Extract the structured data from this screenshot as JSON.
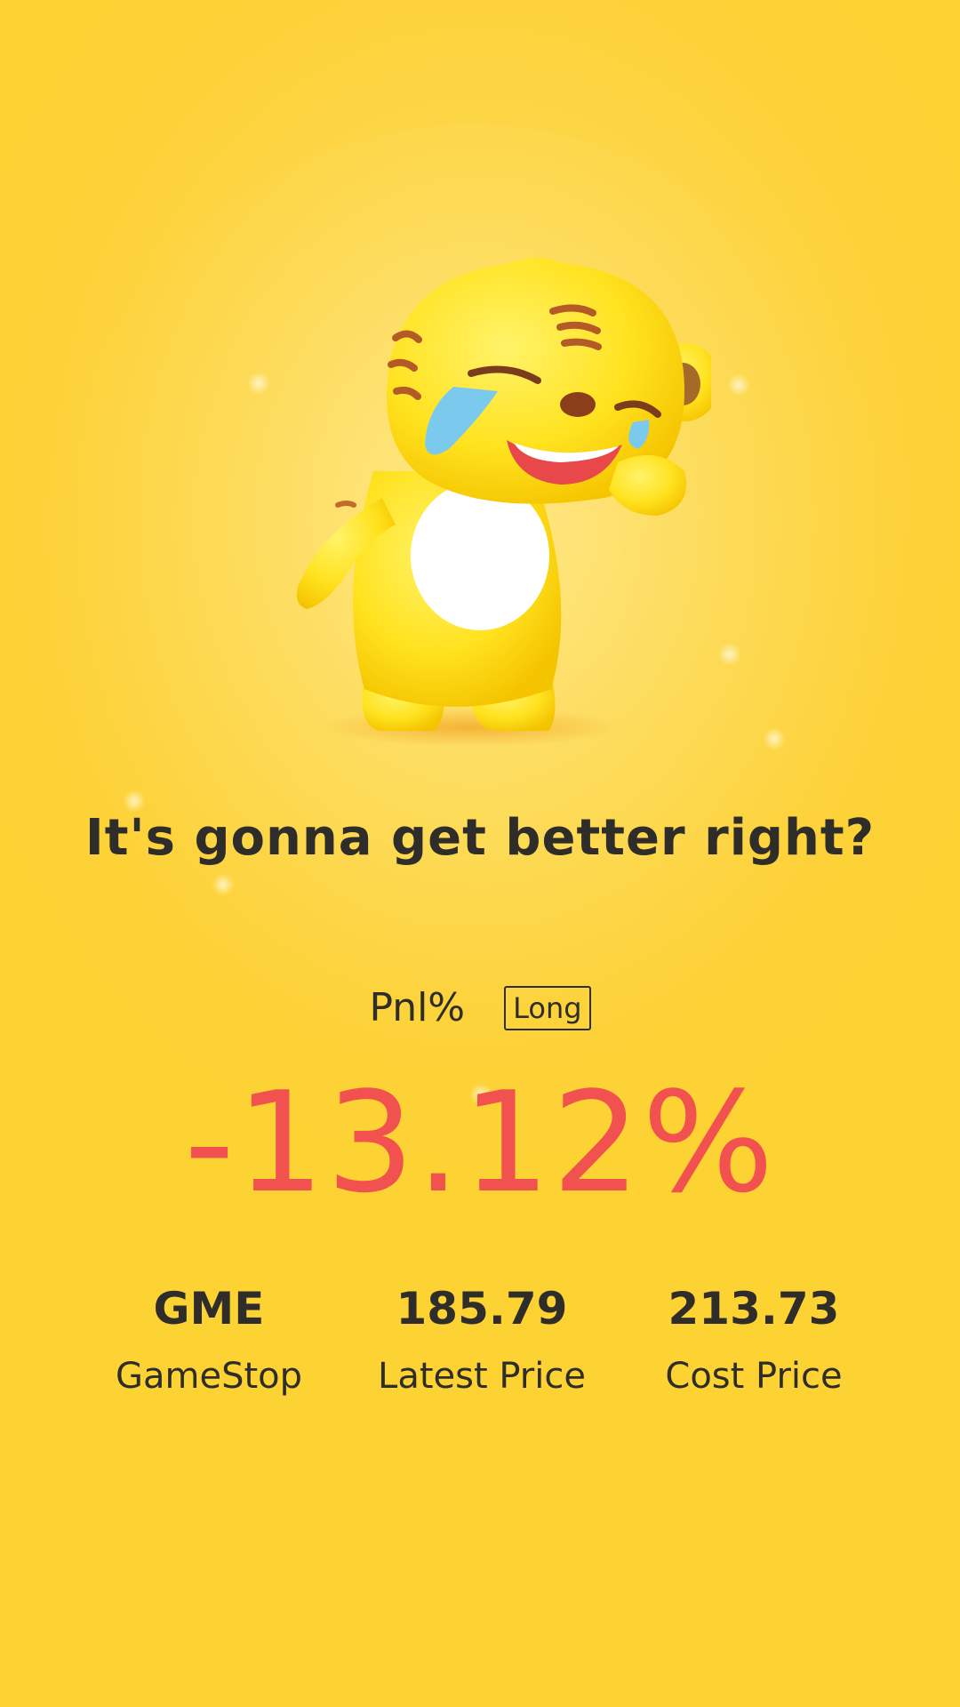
{
  "headline": "It's gonna get better right?",
  "pnl": {
    "label": "Pnl%",
    "position_badge": "Long",
    "value": "-13.12%",
    "value_color": "#f2524f"
  },
  "stats": [
    {
      "value": "GME",
      "label": "GameStop"
    },
    {
      "value": "185.79",
      "label": "Latest Price"
    },
    {
      "value": "213.73",
      "label": "Cost Price"
    }
  ],
  "mascot": {
    "icon": "crying-tiger-mascot-icon"
  },
  "colors": {
    "background": "#fdd233",
    "text": "#2f2d2a"
  }
}
